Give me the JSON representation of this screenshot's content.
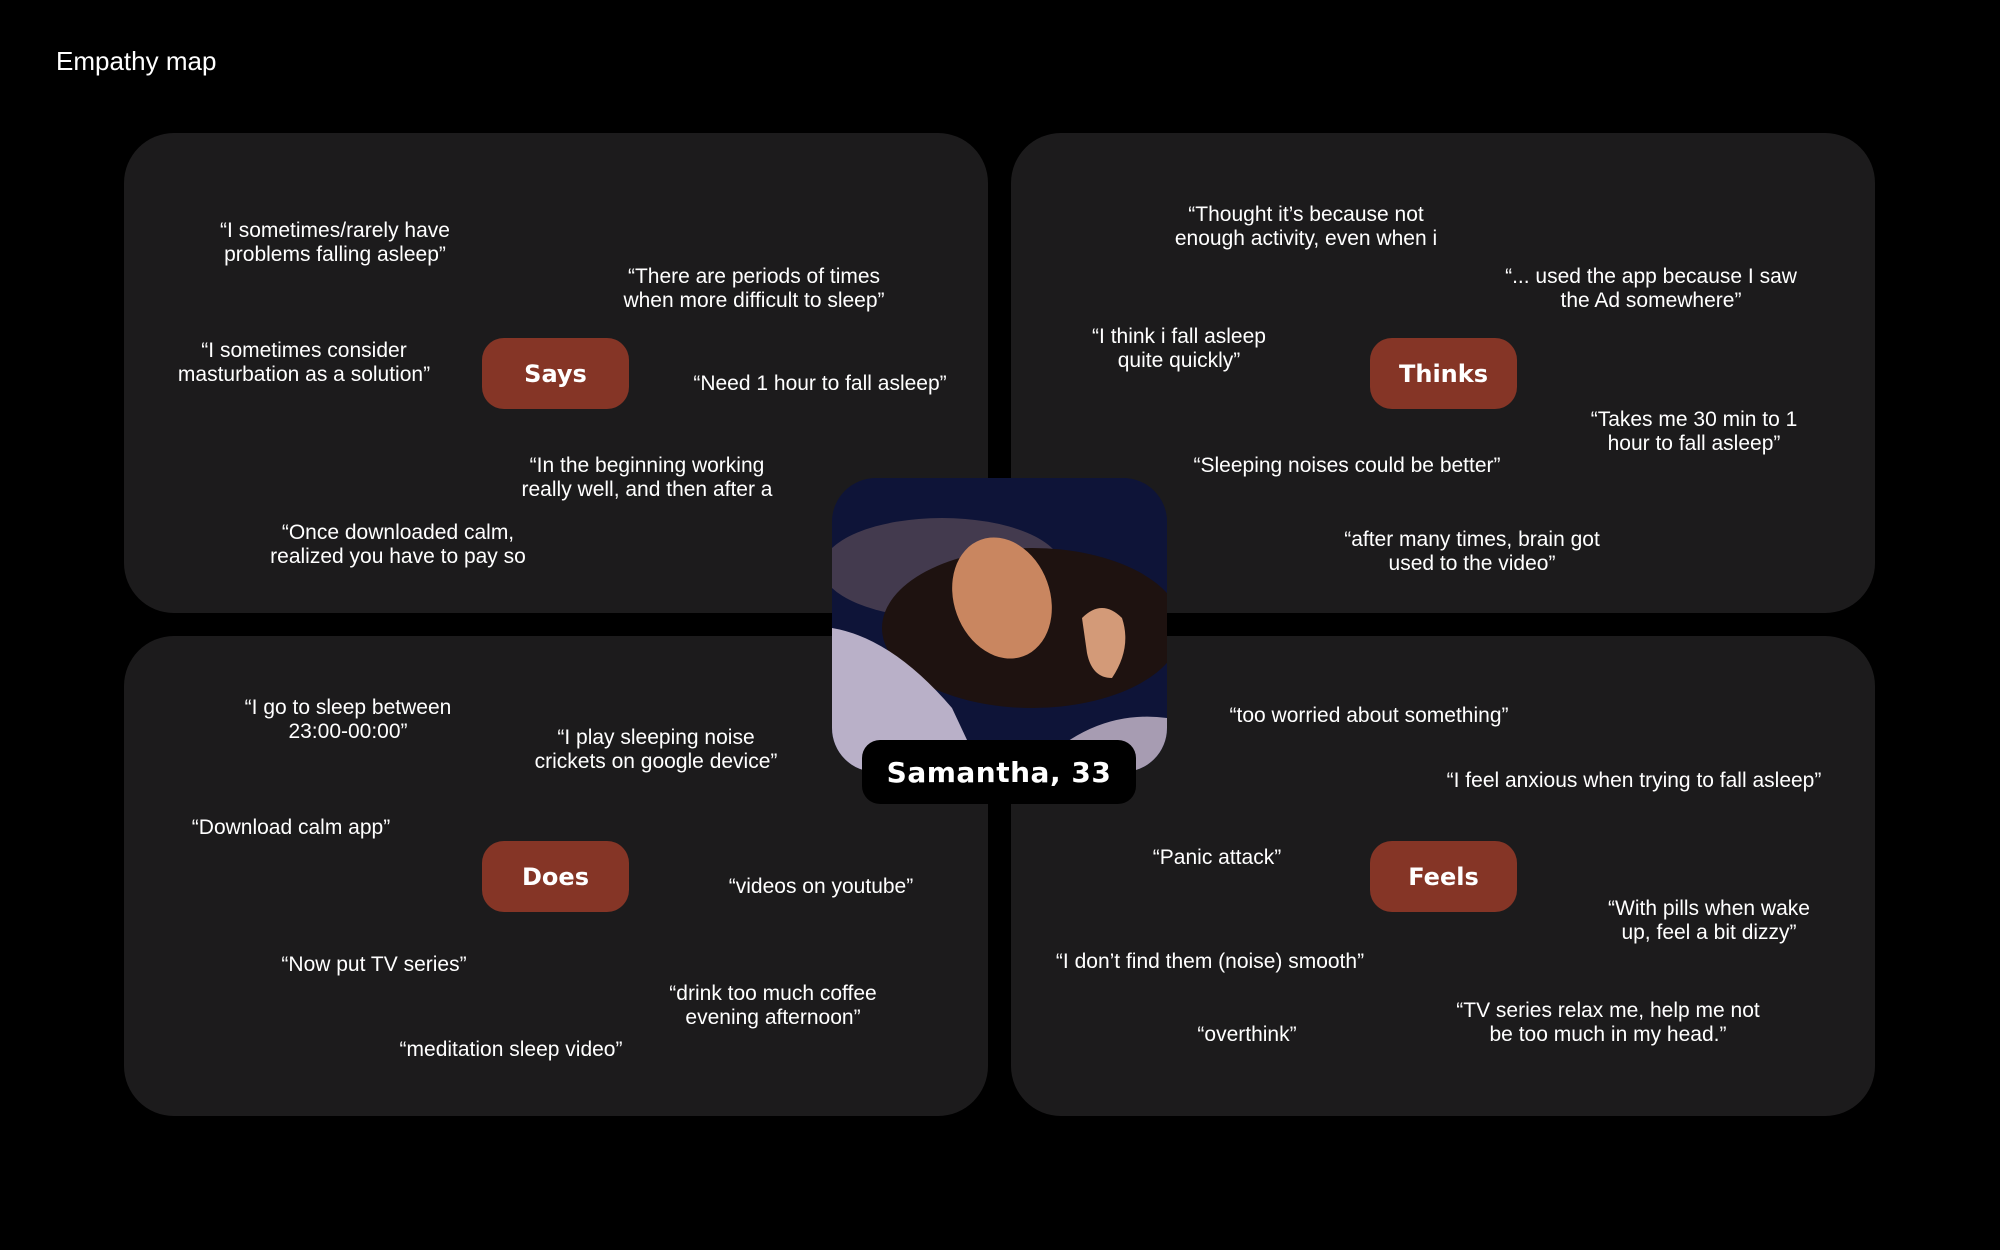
{
  "title": "Empathy map",
  "persona": {
    "name": "Samantha, 33"
  },
  "colors": {
    "background": "#000000",
    "panel": "#1c1b1c",
    "label": "#853526"
  },
  "quadrants": {
    "says": {
      "label": "Says",
      "quotes": [
        "“I sometimes/rarely have\nproblems falling asleep”",
        "“There are periods of times\nwhen more difficult to sleep”",
        "“I sometimes consider\nmasturbation as a solution”",
        "“Need 1 hour to fall asleep”",
        "“In the beginning working\nreally well, and then after a",
        "“Once downloaded calm,\nrealized you have to pay so"
      ]
    },
    "thinks": {
      "label": "Thinks",
      "quotes": [
        "“Thought it’s because not\nenough activity, even when i",
        "“... used the app because I saw\nthe Ad somewhere”",
        "“I think i fall asleep\nquite quickly”",
        "“Takes me 30 min to 1\nhour to fall asleep”",
        "“Sleeping noises could be better”",
        "“after many times, brain got\nused to the video”"
      ]
    },
    "does": {
      "label": "Does",
      "quotes": [
        "“I go to sleep between\n23:00-00:00”",
        "“I play sleeping noise\ncrickets on google device”",
        "“Download calm app”",
        "“videos on youtube”",
        "“Now put TV series”",
        "“drink too much coffee\nevening afternoon”",
        "“meditation sleep video”"
      ]
    },
    "feels": {
      "label": "Feels",
      "quotes": [
        "“too worried about something”",
        "“I feel anxious when trying to fall asleep”",
        "“Panic attack”",
        "“With pills when wake\nup, feel a bit dizzy”",
        "“I don’t find them (noise) smooth”",
        "“TV series relax me, help me not\nbe too much in my head.”",
        "“overthink”"
      ]
    }
  }
}
